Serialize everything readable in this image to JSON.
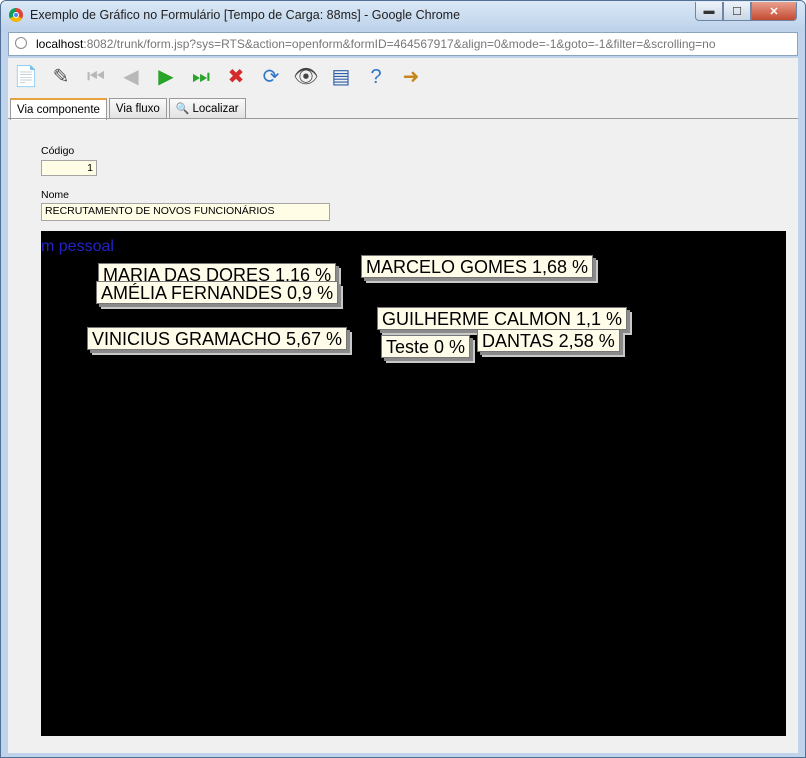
{
  "window": {
    "title": "Exemplo de Gráfico no Formulário [Tempo de Carga: 88ms] - Google Chrome",
    "min_symbol": "▬",
    "max_symbol": "☐",
    "close_symbol": "✕"
  },
  "address_bar": {
    "host": "localhost",
    "rest": ":8082/trunk/form.jsp?sys=RTS&action=openform&formID=464567917&align=0&mode=-1&goto=-1&filter=&scrolling=no"
  },
  "toolbar": {
    "buttons": [
      {
        "name": "new-record",
        "glyph": "📄",
        "color": "#3b7dc4"
      },
      {
        "name": "edit-record",
        "glyph": "✎",
        "color": "#555555"
      },
      {
        "name": "first-record",
        "glyph": "⏮",
        "color": "#b8b8b8"
      },
      {
        "name": "previous-record",
        "glyph": "◀",
        "color": "#b8b8b8"
      },
      {
        "name": "next-record",
        "glyph": "▶",
        "color": "#28a428"
      },
      {
        "name": "last-record",
        "glyph": "⏭",
        "color": "#28a428"
      },
      {
        "name": "delete-record",
        "glyph": "✖",
        "color": "#d42a2a"
      },
      {
        "name": "refresh",
        "glyph": "⟳",
        "color": "#2f77c8"
      },
      {
        "name": "search",
        "glyph": "👁",
        "color": "#444444"
      },
      {
        "name": "form-view",
        "glyph": "▤",
        "color": "#2f5ea8"
      },
      {
        "name": "help",
        "glyph": "?",
        "color": "#2f77c8"
      },
      {
        "name": "exit",
        "glyph": "➜",
        "color": "#c7861b"
      }
    ]
  },
  "tabs": [
    {
      "label": "Via componente",
      "active": true
    },
    {
      "label": "Via fluxo",
      "active": false
    },
    {
      "label": "Localizar",
      "active": false
    }
  ],
  "form": {
    "codigo_label": "Código",
    "codigo_value": "1",
    "nome_label": "Nome",
    "nome_value": "RECRUTAMENTO DE NOVOS FUNCIONÁRIOS"
  },
  "chart_data": {
    "type": "pie",
    "title": "m pessoal",
    "visible_labels": [
      "MARIA DAS DORES 1,16 %",
      "AMÉLIA FERNANDES 0,9 %",
      "VINICIUS GRAMACHO 5,67 %",
      "MARCELO GOMES 1,68 %",
      "GUILHERME CALMON 1,1 %",
      "Teste 0 %",
      "DANTAS 2,58 %"
    ],
    "slices": [
      {
        "label": "MARIA DAS DORES",
        "value": 1.16
      },
      {
        "label": "AMÉLIA FERNANDES",
        "value": 0.9
      },
      {
        "label": "VINICIUS GRAMACHO",
        "value": 5.67
      },
      {
        "label": "MARCELO GOMES",
        "value": 1.68
      },
      {
        "label": "GUILHERME CALMON",
        "value": 1.1
      },
      {
        "label": "Teste",
        "value": 0
      },
      {
        "label": "DANTAS",
        "value": 2.58
      }
    ],
    "background": "#000000",
    "label_background": "#fffde9"
  }
}
